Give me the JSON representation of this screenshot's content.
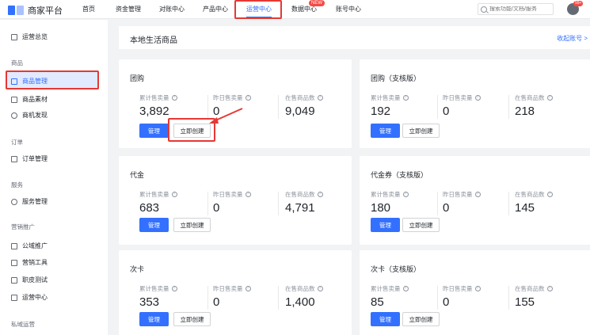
{
  "app": {
    "title": "商家平台"
  },
  "nav": {
    "items": [
      {
        "label": "首页"
      },
      {
        "label": "资金管理"
      },
      {
        "label": "对账中心"
      },
      {
        "label": "产品中心"
      },
      {
        "label": "运营中心"
      },
      {
        "label": "数据中心"
      },
      {
        "label": "账号中心"
      }
    ],
    "data_badge": "NEW",
    "search_placeholder": "搜索功能/文档/服务",
    "avatar_badge": "99+"
  },
  "sidebar": {
    "overview": "运营总览",
    "groups": [
      {
        "label": "商品",
        "items": [
          "商品管理",
          "商品素材",
          "商机发现"
        ]
      },
      {
        "label": "订单",
        "items": [
          "订单管理"
        ]
      },
      {
        "label": "服务",
        "items": [
          "服务管理"
        ]
      },
      {
        "label": "营销推广",
        "items": [
          "公域推广",
          "营销工具",
          "职皮测试",
          "运营中心"
        ]
      },
      {
        "label": "私域运营",
        "items": []
      }
    ]
  },
  "main": {
    "title": "本地生活商品",
    "collect_link": "收起账号 >"
  },
  "labels": {
    "total_sales": "累计售卖量",
    "yesterday_sales": "昨日售卖量",
    "on_sale": "在售商品数",
    "total_sales_b": "累计售卖量",
    "manage": "管理",
    "create": "立即创建"
  },
  "cards": [
    {
      "title": "团购",
      "total": "3,892",
      "yesterday": "0",
      "on_sale": "9,049"
    },
    {
      "title": "团购（支核版）",
      "total": "192",
      "yesterday": "0",
      "on_sale": "218"
    },
    {
      "title": "代金",
      "total": "683",
      "yesterday": "0",
      "on_sale": "4,791"
    },
    {
      "title": "代金券（支核版）",
      "total": "180",
      "yesterday": "0",
      "on_sale": "145"
    },
    {
      "title": "次卡",
      "total": "353",
      "yesterday": "0",
      "on_sale": "1,400"
    },
    {
      "title": "次卡（支核版）",
      "total": "85",
      "yesterday": "0",
      "on_sale": "155"
    }
  ],
  "colors": {
    "accent": "#3370ff",
    "highlight": "#e53935"
  }
}
